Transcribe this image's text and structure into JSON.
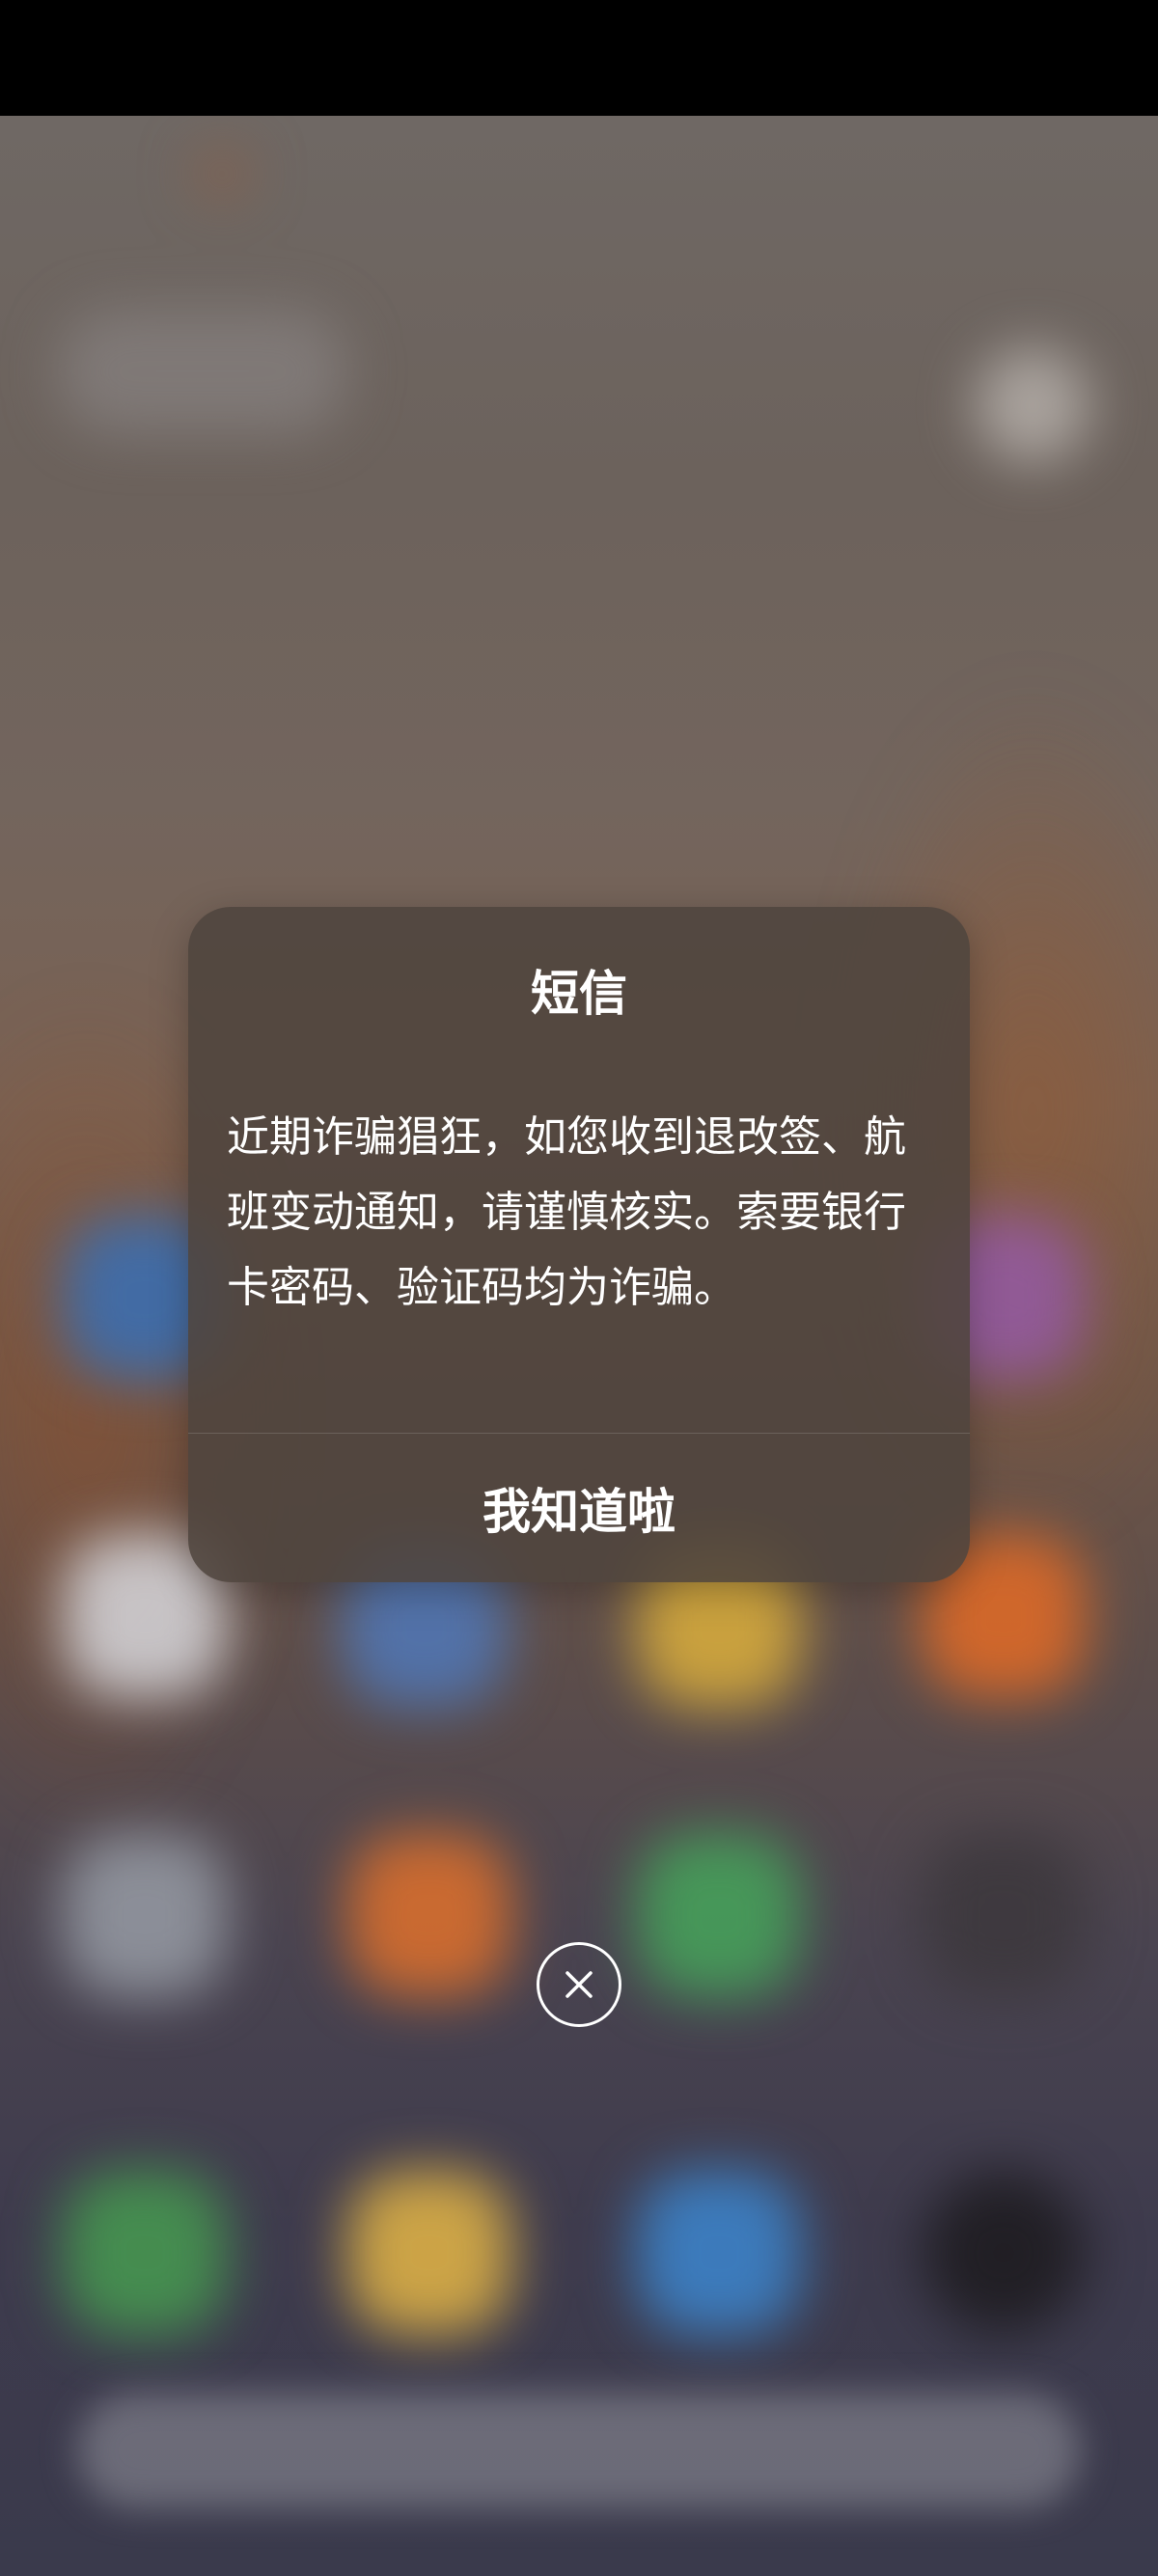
{
  "dialog": {
    "title": "短信",
    "message": "近期诈骗猖狂，如您收到退改签、航班变动通知，请谨慎核实。索要银行卡密码、验证码均为诈骗。",
    "confirm_label": "我知道啦"
  },
  "icons": {
    "close": "close-icon"
  },
  "colors": {
    "dialog_bg": "#4e443e",
    "text": "#ffffff"
  }
}
